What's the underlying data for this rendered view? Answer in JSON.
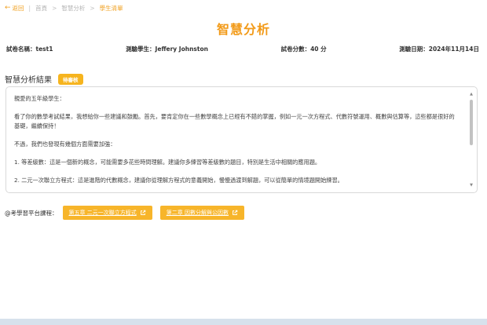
{
  "breadcrumb": {
    "back": "返回",
    "items": [
      "首頁",
      "智慧分析",
      "學生清單"
    ]
  },
  "page": {
    "title": "智慧分析"
  },
  "meta": {
    "paper_name": "試卷名稱：test1",
    "student": "測驗學生：Jeffery Johnston",
    "score": "試卷分數：40 分",
    "date": "測驗日期：2024年11月14日"
  },
  "analysis": {
    "title": "智慧分析結果",
    "badge": "待審核",
    "paragraphs": [
      "親愛的五年級學生：",
      "看了你的數學考試結果，我想給你一些建議和鼓勵。首先，要肯定你在一些數學概念上已經有不錯的掌握，例如一元一次方程式、代數符號運用、概數與估算等，這些都是很好的基礎，繼續保持！",
      "不過，我們也發現有幾個方面需要加強：",
      "1. 等差級數：這是一個新的概念，可能需要多花些時間理解。建議你多練習等差級數的題目，特別是生活中相關的應用題。",
      "2. 二元一次聯立方程式：這是進階的代數概念，建議你從理解方程式的意義開始，慢慢過渡到解題，可以從簡單的情境題開始練習。"
    ]
  },
  "courses": {
    "label": "@考學習平台課程：",
    "items": [
      "第五章 二元一次聯立方程式",
      "第二章 因數分解與公因數"
    ]
  },
  "colors": {
    "accent": "#f29a18",
    "button": "#f7b52a",
    "badge": "#f6b41e"
  },
  "icons": {
    "back": "left-arrow-icon",
    "external": "external-link-icon"
  }
}
